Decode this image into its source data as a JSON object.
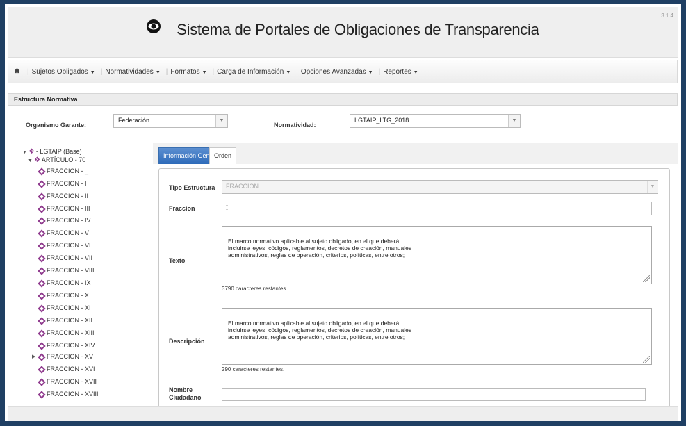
{
  "header": {
    "title": "Sistema de Portales de Obligaciones de Transparencia",
    "version": "3.1.4"
  },
  "nav": {
    "home_icon": "home-icon",
    "items": [
      {
        "label": "Sujetos Obligados"
      },
      {
        "label": "Normatividades"
      },
      {
        "label": "Formatos"
      },
      {
        "label": "Carga de Información"
      },
      {
        "label": "Opciones Avanzadas"
      },
      {
        "label": "Reportes"
      }
    ]
  },
  "section": {
    "title": "Estructura Normativa"
  },
  "filters": {
    "organismo_label": "Organismo Garante:",
    "organismo_value": "Federación",
    "normatividad_label": "Normatividad:",
    "normatividad_value": "LGTAIP_LTG_2018"
  },
  "tree": {
    "root": "- LGTAIP (Base)",
    "article": "ARTÍCULO - 70",
    "items": [
      "FRACCION - _",
      "FRACCION - I",
      "FRACCION - II",
      "FRACCION - III",
      "FRACCION - IV",
      "FRACCION - V",
      "FRACCION - VI",
      "FRACCION - VII",
      "FRACCION - VIII",
      "FRACCION - IX",
      "FRACCION - X",
      "FRACCION - XI",
      "FRACCION - XII",
      "FRACCION - XIII",
      "FRACCION - XIV",
      "FRACCION - XV",
      "FRACCION - XVI",
      "FRACCION - XVII",
      "FRACCION - XVIII"
    ]
  },
  "tabs": {
    "general": "Información General",
    "orden": "Orden"
  },
  "form": {
    "tipo_label": "Tipo Estructura",
    "tipo_value": "FRACCION",
    "fraccion_label": "Fraccion",
    "fraccion_value": "I",
    "texto_label": "Texto",
    "texto_value": "El marco normativo aplicable al sujeto obligado, en el que deberá\nincluirse leyes, códigos, reglamentos, decretos de creación, manuales\nadministrativos, reglas de operación, criterios, políticas, entre otros;",
    "texto_remaining": "3790 caracteres restantes.",
    "descripcion_label": "Descripción",
    "descripcion_value": "El marco normativo aplicable al sujeto obligado, en el que deberá\nincluirse leyes, códigos, reglamentos, decretos de creación, manuales\nadministrativos, reglas de operación, criterios, políticas, entre otros;",
    "descripcion_remaining": "290 caracteres restantes.",
    "nombre_label": "Nombre Ciudadano",
    "nombre_value": ""
  },
  "colors": {
    "tab_active": "#2e6bba",
    "tree_icon": "#8f3a8d",
    "outer_border": "#1f3f63"
  }
}
